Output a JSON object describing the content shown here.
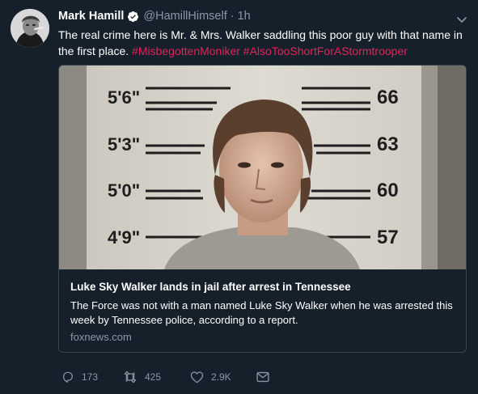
{
  "tweet": {
    "author_name": "Mark Hamill",
    "handle": "@HamillHimself",
    "separator": "·",
    "time": "1h",
    "text_plain": "The real crime here is Mr. & Mrs. Walker saddling this poor guy with that name in the first place. ",
    "hashtags": [
      "#MisbegottenMoniker",
      "#AlsoTooShortForAStormtrooper"
    ]
  },
  "card": {
    "image_heights": {
      "left": [
        "5'6\"",
        "5'3\"",
        "5'0\"",
        "4'9\""
      ],
      "right": [
        "66",
        "63",
        "60",
        "57"
      ]
    },
    "title": "Luke Sky Walker lands in jail after arrest in Tennessee",
    "description": "The Force was not with a man named Luke Sky Walker when he was arrested this week by Tennessee police, according to a report.",
    "domain": "foxnews.com"
  },
  "actions": {
    "replies": "173",
    "retweets": "425",
    "likes": "2.9K"
  },
  "icons": {
    "verified": "verified-badge-icon",
    "caret": "chevron-down-icon",
    "reply": "reply-icon",
    "retweet": "retweet-icon",
    "like": "heart-icon",
    "message": "direct-message-icon"
  },
  "colors": {
    "background": "#15202b",
    "hashtag": "#e0245e",
    "muted": "#8899a6",
    "verified": "#1da1f2",
    "border": "#38444d"
  }
}
